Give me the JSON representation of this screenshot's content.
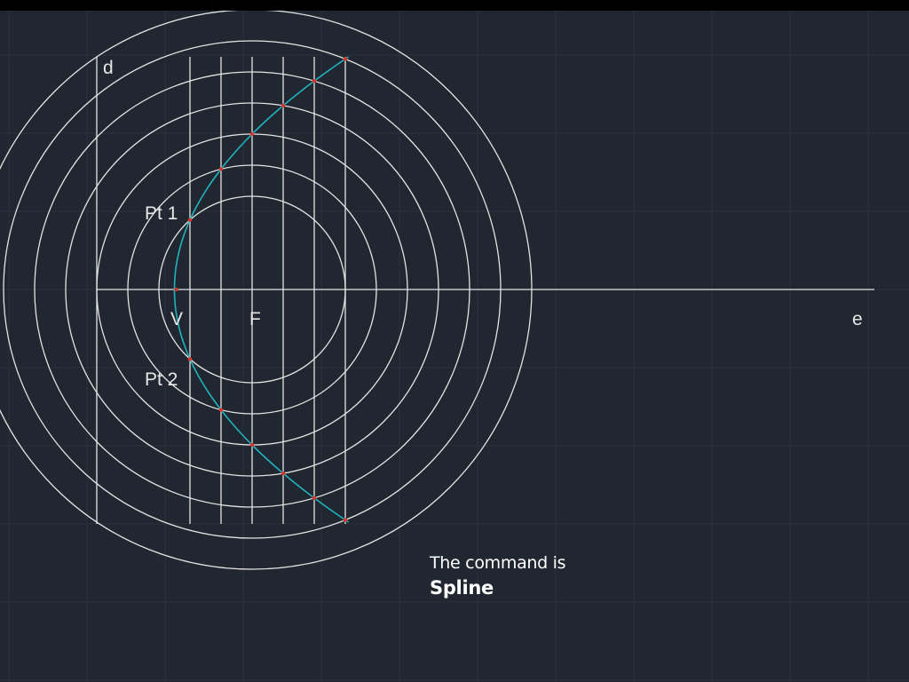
{
  "drawing": {
    "labels": {
      "directrix": "d",
      "axis_end": "e",
      "vertex": "V",
      "focus": "F",
      "point_1": "Pt 1",
      "point_2": "Pt 2"
    },
    "colors": {
      "background": "#212730",
      "grid": "#2b313b",
      "geometry": "#e3e3e3",
      "spline": "#1fb4be",
      "markers": "#d9342b"
    },
    "circle_count": 7,
    "vertical_line_count": 6
  },
  "caption": {
    "line1": "The command is",
    "line2": "Spline"
  }
}
